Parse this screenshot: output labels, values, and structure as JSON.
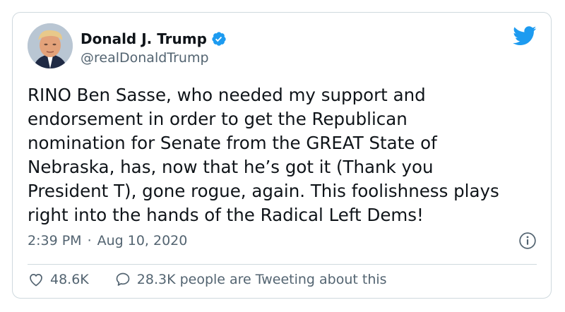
{
  "author": {
    "display_name": "Donald J. Trump",
    "handle": "@realDonaldTrump",
    "verified": true
  },
  "tweet": {
    "text": "RINO Ben Sasse, who needed my support and\nendorsement in order to get the Republican\nnomination for Senate from the GREAT State of\nNebraska, has, now that he’s got it (Thank you\nPresident T), gone rogue, again. This foolishness plays\nright into the hands of the Radical Left Dems!",
    "time": "2:39 PM",
    "separator": "·",
    "date": "Aug 10, 2020"
  },
  "actions": {
    "likes": "48.6K",
    "conversation": "28.3K people are Tweeting about this"
  },
  "icons": {
    "logo": "twitter-bird-icon",
    "verified": "verified-badge-icon",
    "info": "info-icon",
    "like": "heart-icon",
    "reply": "speech-bubble-icon"
  },
  "colors": {
    "brand": "#1d9bf0",
    "text": "#0f1419",
    "secondary": "#536471",
    "border": "#cfd9de"
  }
}
